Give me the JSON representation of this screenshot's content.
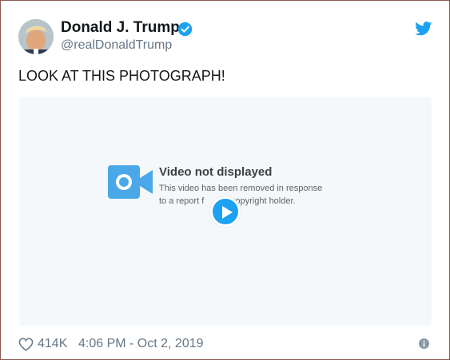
{
  "tweet": {
    "author_name": "Donald J. Trump",
    "author_handle": "@realDonaldTrump",
    "text": "LOOK AT THIS PHOTOGRAPH!",
    "verified_icon": "verified-badge-icon",
    "brand_icon": "twitter-bird-icon"
  },
  "media": {
    "title": "Video not displayed",
    "line1": "This video has been removed in response",
    "line2": "to a report f        e copyright holder.",
    "camera_icon": "video-camera-icon",
    "play_icon": "play-icon"
  },
  "footer": {
    "likes": "414K",
    "timestamp": "4:06 PM - Oct 2, 2019",
    "heart_icon": "heart-icon",
    "info_icon": "info-icon"
  },
  "colors": {
    "brand_blue": "#1da1f2",
    "text_primary": "#14171a",
    "text_secondary": "#657786",
    "media_bg": "#f5f8fa"
  }
}
